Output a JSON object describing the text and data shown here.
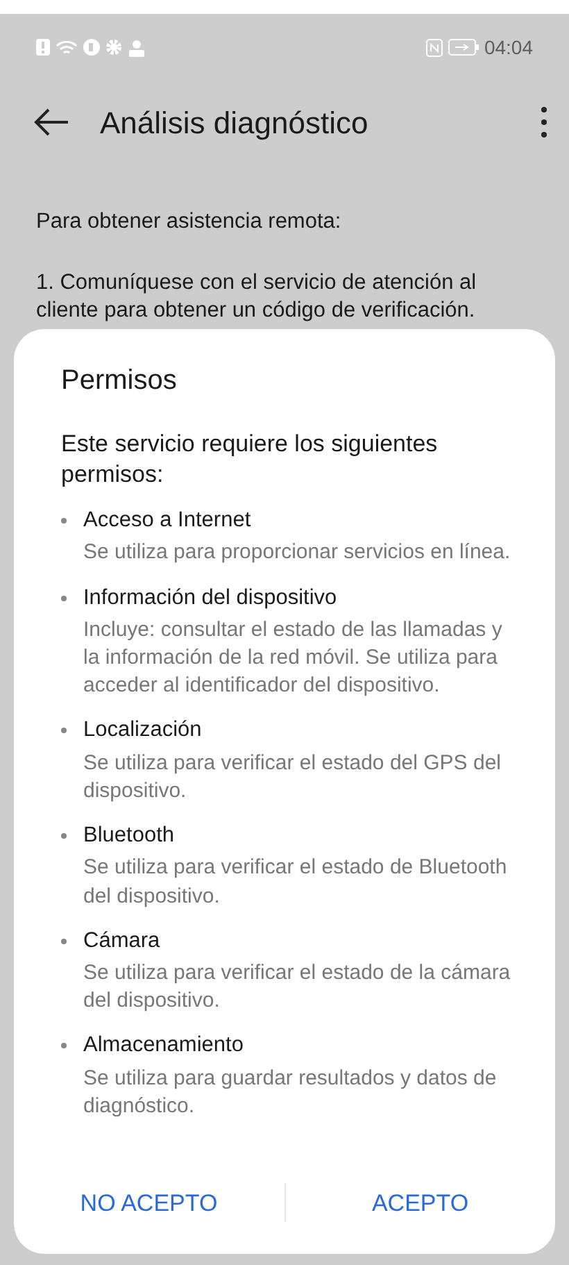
{
  "status_bar": {
    "time": "04:04"
  },
  "header": {
    "title": "Análisis diagnóstico"
  },
  "content": {
    "paragraphs": [
      "Para obtener asistencia remota:",
      "1. Comuníquese con el servicio de atención al cliente para obtener un código de verificación."
    ]
  },
  "dialog": {
    "title": "Permisos",
    "intro": "Este servicio requiere los siguientes permisos:",
    "permissions": [
      {
        "name": "Acceso a Internet",
        "description": "Se utiliza para proporcionar servicios en línea."
      },
      {
        "name": "Información del dispositivo",
        "description": "Incluye: consultar el estado de las llamadas y la información de la red móvil. Se utiliza para acceder al identificador del dispositivo."
      },
      {
        "name": "Localización",
        "description": "Se utiliza para verificar el estado del GPS del dispositivo."
      },
      {
        "name": "Bluetooth",
        "description": "Se utiliza para verificar el estado de Bluetooth del dispositivo."
      },
      {
        "name": "Cámara",
        "description": "Se utiliza para verificar el estado de la cámara del dispositivo."
      },
      {
        "name": "Almacenamiento",
        "description": "Se utiliza para guardar resultados y datos de diagnóstico."
      }
    ],
    "buttons": [
      "NO ACEPTO",
      "ACEPTO"
    ]
  }
}
